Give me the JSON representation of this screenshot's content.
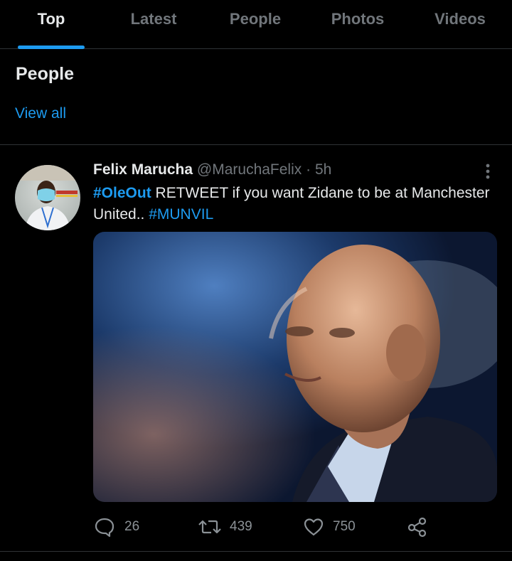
{
  "tabs": [
    {
      "label": "Top",
      "active": true
    },
    {
      "label": "Latest",
      "active": false
    },
    {
      "label": "People",
      "active": false
    },
    {
      "label": "Photos",
      "active": false
    },
    {
      "label": "Videos",
      "active": false
    }
  ],
  "people_section": {
    "title": "People",
    "view_all": "View all"
  },
  "tweet": {
    "author_name": "Felix Marucha",
    "handle": "@MaruchaFelix",
    "separator": "·",
    "time": "5h",
    "text": {
      "hashtag1": "#OleOut",
      "body": " RETWEET if you want Zidane to be at Manchester United.. ",
      "hashtag2": "#MUNVIL"
    },
    "actions": {
      "replies": "26",
      "retweets": "439",
      "likes": "750"
    }
  },
  "icons": {
    "reply": "speech-bubble-icon",
    "retweet": "retweet-icon",
    "like": "heart-icon",
    "share": "share-nodes-icon",
    "more": "vertical-dots-icon"
  },
  "colors": {
    "background": "#000000",
    "accent": "#1d9bf0",
    "text_primary": "#e7e9ea",
    "text_secondary": "#71767b",
    "divider": "#2f3336"
  }
}
